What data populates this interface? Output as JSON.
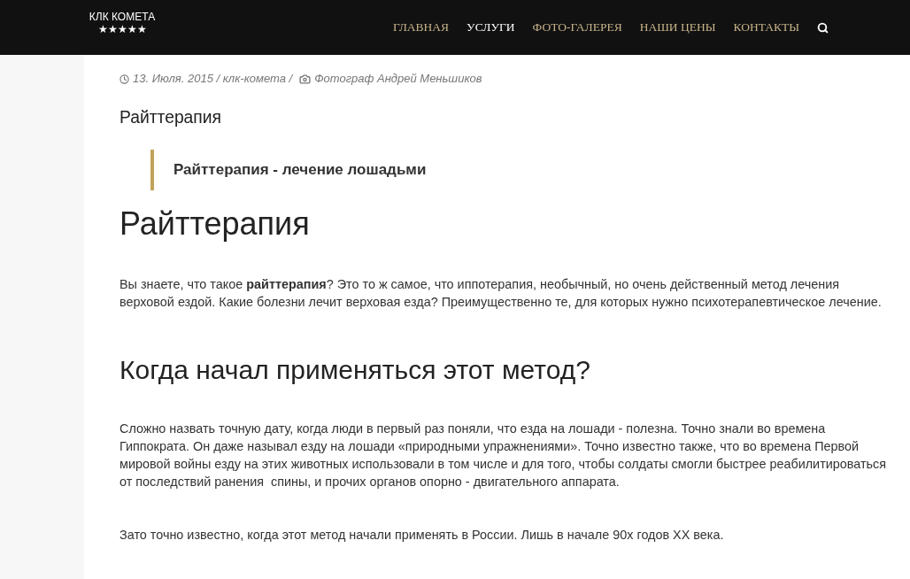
{
  "header": {
    "logo": {
      "name": "КЛК КОМЕТА",
      "stars": "★★★★★"
    },
    "nav": [
      {
        "label": "ГЛАВНАЯ",
        "selected": false
      },
      {
        "label": "УСЛУГИ",
        "selected": true
      },
      {
        "label": "ФОТО-ГАЛЕРЕЯ",
        "selected": false
      },
      {
        "label": "НАШИ ЦЕНЫ",
        "selected": false
      },
      {
        "label": "КОНТАКТЫ",
        "selected": false
      }
    ]
  },
  "post": {
    "meta": {
      "date_line": "13. Июля. 2015 / клк-комета /",
      "author": "Фотограф Андрей Меньшиков"
    },
    "title": "Райттерапия",
    "quote": "Райттерапия - лечение лошадьми",
    "content": [
      {
        "kind": "heading1",
        "text": "Райттерапия"
      },
      {
        "kind": "paragraph",
        "text": "Вы знаете, что такое **райттерапия**? Это то ж самое, что иппотерапия, необычный, но очень действенный метод лечения верховой ездой. Какие болезни лечит верховая езда? Преимущественно те, для которых нужно психотерапевтическое лечение."
      },
      {
        "kind": "heading2",
        "text": "Когда начал применяться этот метод?"
      },
      {
        "kind": "paragraph",
        "text": "Сложно назвать точную дату, когда люди в первый раз поняли, что езда на лошади - полезна. Точно знали во времена Гиппократа. Он даже называл езду на лошади «природными упражнениями». Точно известно также, что во времена Первой мировой войны езду на этих животных использовали в том числе и для того, чтобы солдаты смогли быстрее реабилитироваться от последствий ранения  спины, и прочих органов опорно - двигательного аппарата."
      },
      {
        "kind": "paragraph",
        "text": "Зато точно известно, когда этот метод начали применять в России. Лишь в начале 90х годов XX века."
      }
    ]
  }
}
